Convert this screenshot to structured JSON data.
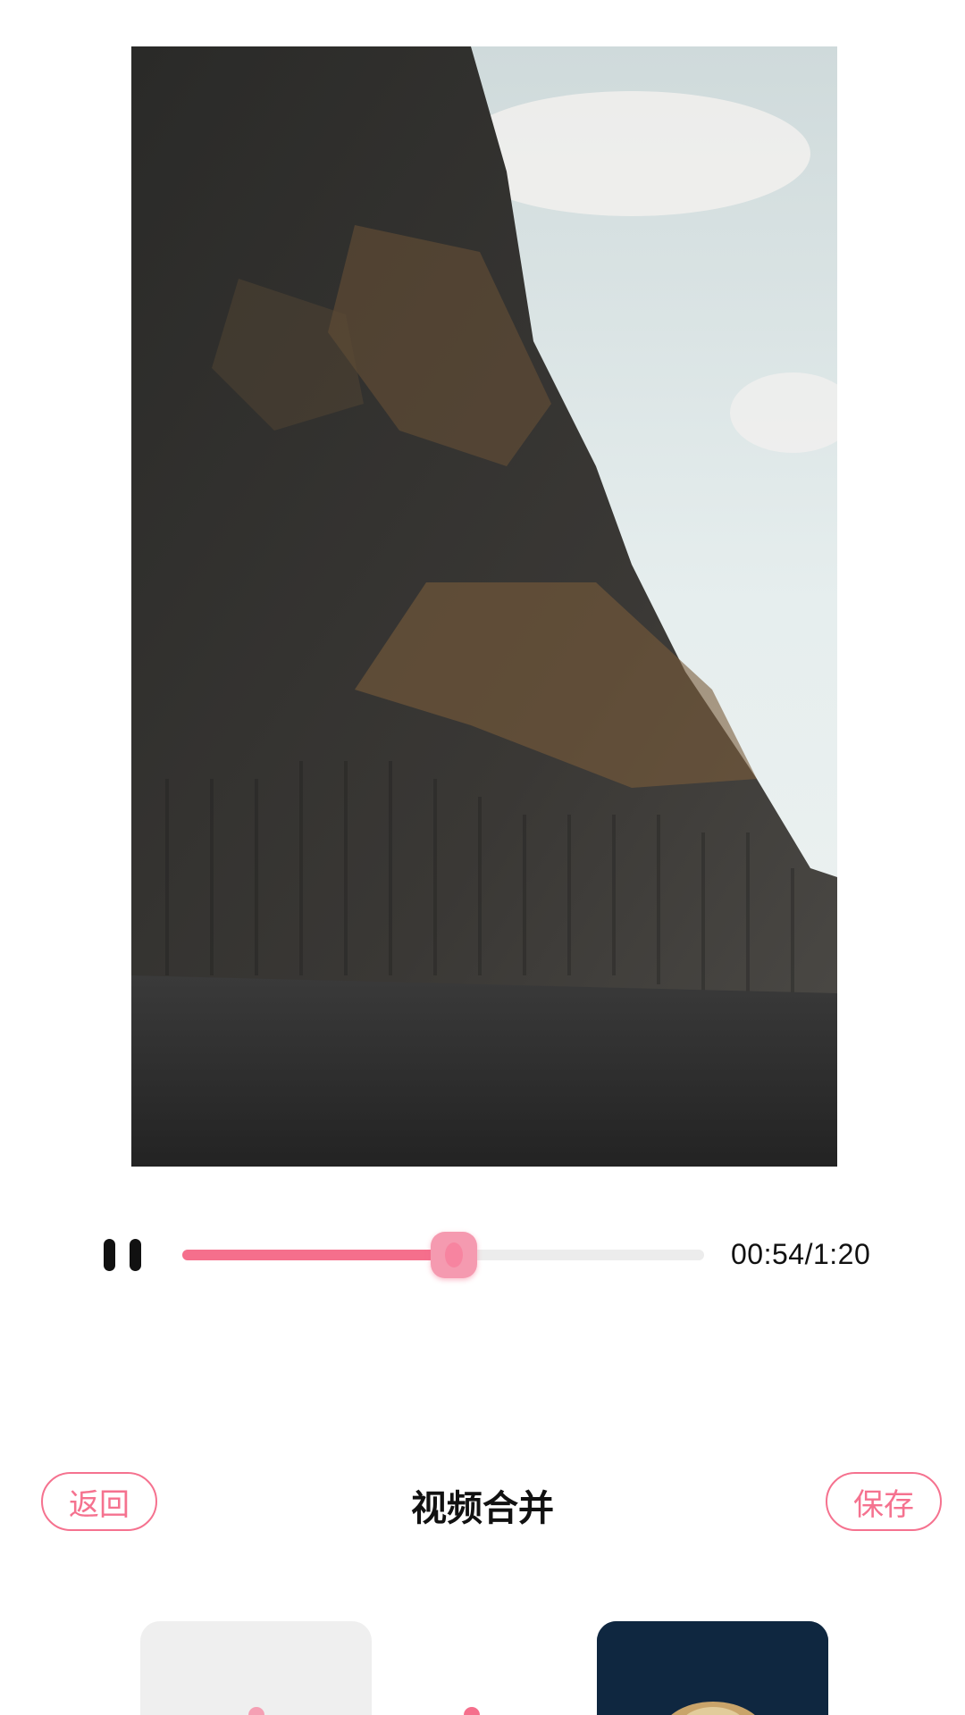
{
  "player": {
    "time_text": "00:54/1:20",
    "progress": 0.52,
    "state": "playing",
    "pause_icon": "pause-icon"
  },
  "toolbar": {
    "back_label": "返回",
    "title": "视频合并",
    "save_label": "保存"
  },
  "colors": {
    "accent": "#f56f8c",
    "track": "#ececec"
  }
}
